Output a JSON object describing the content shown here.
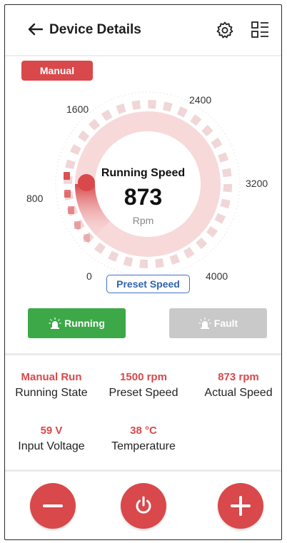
{
  "header": {
    "title": "Device Details"
  },
  "mode": {
    "label": "Manual"
  },
  "gauge": {
    "label": "Running Speed",
    "value": "873",
    "unit": "Rpm",
    "scale_labels": [
      "0",
      "800",
      "1600",
      "2400",
      "3200",
      "4000"
    ],
    "min": 0,
    "max": 4000,
    "current": 873,
    "preset_chip": "Preset Speed"
  },
  "status": {
    "running_label": "Running",
    "fault_label": "Fault",
    "running_color": "#3da848",
    "fault_color": "#c9c9c9"
  },
  "info": [
    {
      "value": "Manual Run",
      "label": "Running State"
    },
    {
      "value": "1500 rpm",
      "label": "Preset Speed"
    },
    {
      "value": "873 rpm",
      "label": "Actual Speed"
    },
    {
      "value": "59 V",
      "label": "Input Voltage"
    },
    {
      "value": "38 °C",
      "label": "Temperature"
    }
  ],
  "controls": {
    "decrease_icon": "minus-icon",
    "power_icon": "power-icon",
    "increase_icon": "plus-icon"
  },
  "colors": {
    "accent": "#d9484a",
    "running": "#3da848",
    "preset_blue": "#3e73c4"
  }
}
